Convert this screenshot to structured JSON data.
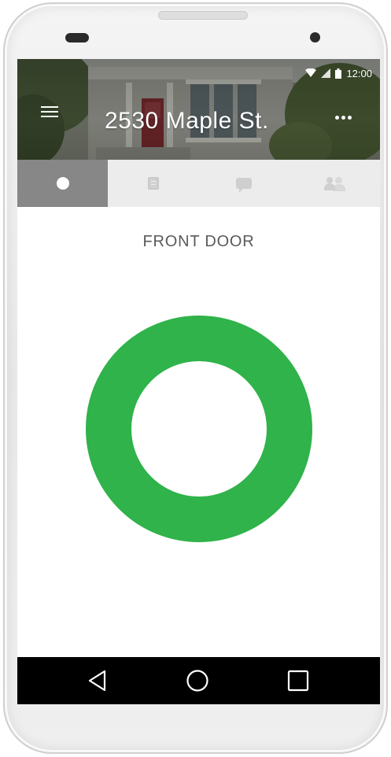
{
  "status_bar": {
    "time": "12:00",
    "icons": [
      "wifi-icon",
      "signal-icon",
      "battery-icon"
    ]
  },
  "header": {
    "address": "2530 Maple St.",
    "menu_icon": "hamburger-menu-icon",
    "more_icon": "more-dots-icon"
  },
  "tabs": [
    {
      "icon": "lock-status-icon",
      "active": true
    },
    {
      "icon": "activity-log-icon",
      "active": false
    },
    {
      "icon": "messages-icon",
      "active": false
    },
    {
      "icon": "users-icon",
      "active": false
    }
  ],
  "lock": {
    "title": "FRONT DOOR",
    "color": "#2fb34a"
  },
  "navbar": {
    "icons": [
      "back-icon",
      "home-icon",
      "recents-icon"
    ]
  },
  "colors": {
    "active_tab": "#878787",
    "tab_bar": "#ececec",
    "lock_ring": "#2fb34a"
  }
}
